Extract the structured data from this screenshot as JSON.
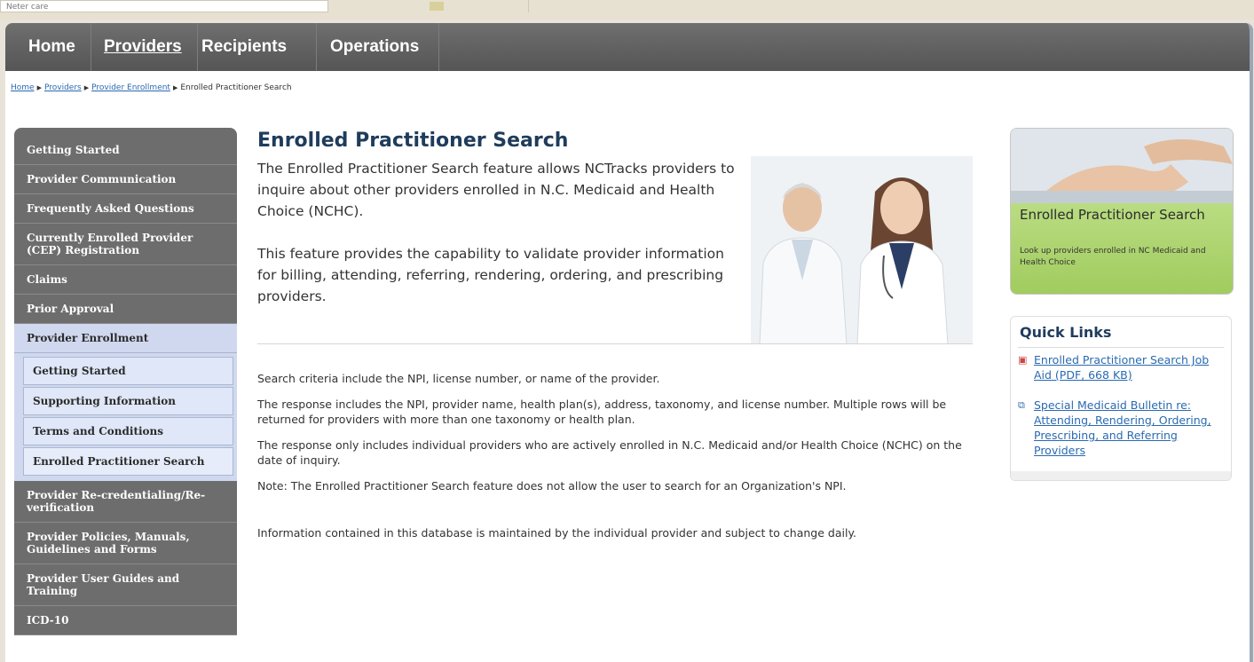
{
  "browser": {
    "address_text": "Neter care"
  },
  "nav": {
    "items": [
      {
        "label": "Home",
        "active": false
      },
      {
        "label": "Providers",
        "active": true
      },
      {
        "label": "Recipients",
        "active": false
      },
      {
        "label": "Operations",
        "active": false
      }
    ]
  },
  "breadcrumb": {
    "links": [
      "Home",
      "Providers",
      "Provider Enrollment"
    ],
    "current": "Enrolled Practitioner Search"
  },
  "sidebar": {
    "items": [
      {
        "label": "Getting Started"
      },
      {
        "label": "Provider Communication"
      },
      {
        "label": "Frequently Asked Questions"
      },
      {
        "label": "Currently Enrolled Provider (CEP) Registration"
      },
      {
        "label": "Claims"
      },
      {
        "label": "Prior Approval"
      },
      {
        "label": "Provider Enrollment"
      }
    ],
    "subitems": [
      {
        "label": "Getting Started"
      },
      {
        "label": "Supporting Information"
      },
      {
        "label": "Terms and Conditions"
      },
      {
        "label": "Enrolled Practitioner Search"
      }
    ],
    "items_after": [
      {
        "label": "Provider Re-credentialing/Re-verification"
      },
      {
        "label": "Provider Policies, Manuals, Guidelines and Forms"
      },
      {
        "label": "Provider User Guides and Training"
      },
      {
        "label": "ICD-10"
      }
    ]
  },
  "main": {
    "title": "Enrolled Practitioner Search",
    "intro_1": "The Enrolled Practitioner Search feature allows NCTracks providers to inquire about other providers enrolled in N.C. Medicaid and Health Choice (NCHC).",
    "intro_2": "This feature provides the capability to validate provider information for billing, attending, referring, rendering, ordering, and prescribing providers.",
    "para_1": "Search criteria include the NPI, license number, or name of the provider.",
    "para_2": "The response includes the NPI, provider name, health plan(s), address, taxonomy, and license number. Multiple rows will be returned for providers with more than one taxonomy or health plan.",
    "para_3": "The response only includes individual providers who are actively enrolled in N.C. Medicaid and/or Health Choice (NCHC) on the date of inquiry.",
    "para_4": "Note: The Enrolled Practitioner Search feature does not allow the user to search for an Organization's NPI.",
    "para_5": "Information contained in this database is maintained by the individual provider and subject to change daily."
  },
  "promo": {
    "title": "Enrolled Practitioner Search",
    "text": "Look up providers enrolled in NC Medicaid and Health Choice"
  },
  "quick_links": {
    "title": "Quick Links",
    "links": [
      {
        "label": "Enrolled Practitioner Search Job Aid (PDF, 668 KB)",
        "icon": "pdf-icon"
      },
      {
        "label": "Special Medicaid Bulletin re: Attending, Rendering, Ordering, Prescribing, and Referring Providers",
        "icon": "external-link-icon"
      }
    ]
  },
  "colors": {
    "nav_bg": "#5f5f5f",
    "sidebar_bg": "#6d6d6d",
    "sidebar_selected": "#cfd8ee",
    "title_blue": "#1f3c5c",
    "link_blue": "#2a6ab0",
    "promo_green": "#a8d26a"
  }
}
